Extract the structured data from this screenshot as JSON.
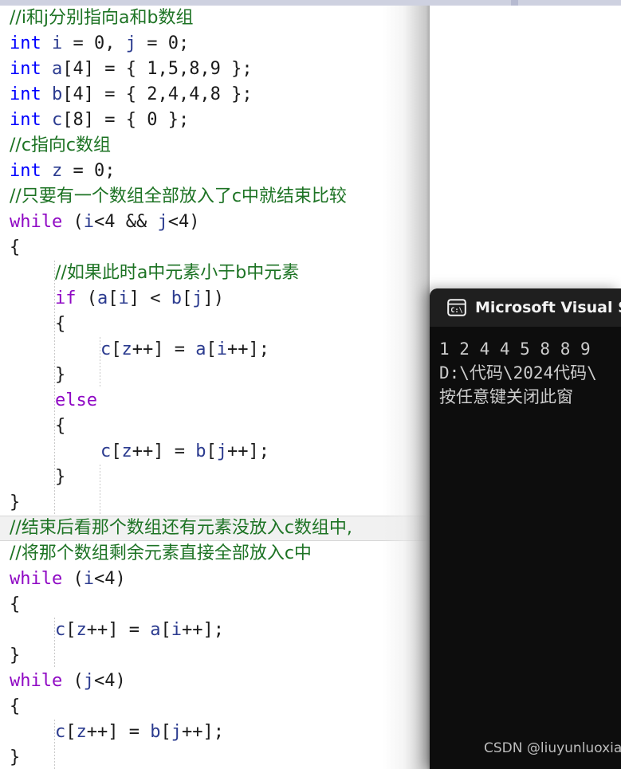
{
  "window": {
    "title": "Visual Studio code editor with console output"
  },
  "top_scrollbar": {
    "track_color": "#ced1e0",
    "thumb_color": "#b6bad0"
  },
  "editor": {
    "background": "#ffffff",
    "font_size_px": 22,
    "line_height_px": 32,
    "current_line_index": 20,
    "colors": {
      "comment": "#1d7324",
      "keyword": "#0000ff",
      "control": "#8f08c4",
      "identifier": "#2b3b8f",
      "plain": "#1b1b1b"
    },
    "lines": [
      {
        "indent": 0,
        "tokens": [
          {
            "t": "//i和j分别指向a和b数组",
            "c": "comment"
          }
        ]
      },
      {
        "indent": 0,
        "tokens": [
          {
            "t": "int",
            "c": "keyword"
          },
          {
            "t": " ",
            "c": "plain"
          },
          {
            "t": "i",
            "c": "identifier"
          },
          {
            "t": " = ",
            "c": "plain"
          },
          {
            "t": "0",
            "c": "plain"
          },
          {
            "t": ", ",
            "c": "plain"
          },
          {
            "t": "j",
            "c": "identifier"
          },
          {
            "t": " = ",
            "c": "plain"
          },
          {
            "t": "0;",
            "c": "plain"
          }
        ]
      },
      {
        "indent": 0,
        "tokens": [
          {
            "t": "int",
            "c": "keyword"
          },
          {
            "t": " ",
            "c": "plain"
          },
          {
            "t": "a",
            "c": "identifier"
          },
          {
            "t": "[4] = { 1,5,8,9 };",
            "c": "plain"
          }
        ]
      },
      {
        "indent": 0,
        "tokens": [
          {
            "t": "int",
            "c": "keyword"
          },
          {
            "t": " ",
            "c": "plain"
          },
          {
            "t": "b",
            "c": "identifier"
          },
          {
            "t": "[4] = { 2,4,4,8 };",
            "c": "plain"
          }
        ]
      },
      {
        "indent": 0,
        "tokens": [
          {
            "t": "int",
            "c": "keyword"
          },
          {
            "t": " ",
            "c": "plain"
          },
          {
            "t": "c",
            "c": "identifier"
          },
          {
            "t": "[8] = { 0 };",
            "c": "plain"
          }
        ]
      },
      {
        "indent": 0,
        "tokens": [
          {
            "t": "//c指向c数组",
            "c": "comment"
          }
        ]
      },
      {
        "indent": 0,
        "tokens": [
          {
            "t": "int",
            "c": "keyword"
          },
          {
            "t": " ",
            "c": "plain"
          },
          {
            "t": "z",
            "c": "identifier"
          },
          {
            "t": " = ",
            "c": "plain"
          },
          {
            "t": "0;",
            "c": "plain"
          }
        ]
      },
      {
        "indent": 0,
        "tokens": [
          {
            "t": "//只要有一个数组全部放入了c中就结束比较",
            "c": "comment"
          }
        ]
      },
      {
        "indent": 0,
        "tokens": [
          {
            "t": "while",
            "c": "control"
          },
          {
            "t": " (",
            "c": "plain"
          },
          {
            "t": "i",
            "c": "identifier"
          },
          {
            "t": "<4 && ",
            "c": "plain"
          },
          {
            "t": "j",
            "c": "identifier"
          },
          {
            "t": "<4)",
            "c": "plain"
          }
        ]
      },
      {
        "indent": 0,
        "tokens": [
          {
            "t": "{",
            "c": "plain"
          }
        ]
      },
      {
        "indent": 1,
        "tokens": [
          {
            "t": "//如果此时a中元素小于b中元素",
            "c": "comment"
          }
        ]
      },
      {
        "indent": 1,
        "tokens": [
          {
            "t": "if",
            "c": "control"
          },
          {
            "t": " (",
            "c": "plain"
          },
          {
            "t": "a",
            "c": "identifier"
          },
          {
            "t": "[",
            "c": "plain"
          },
          {
            "t": "i",
            "c": "identifier"
          },
          {
            "t": "] < ",
            "c": "plain"
          },
          {
            "t": "b",
            "c": "identifier"
          },
          {
            "t": "[",
            "c": "plain"
          },
          {
            "t": "j",
            "c": "identifier"
          },
          {
            "t": "])",
            "c": "plain"
          }
        ]
      },
      {
        "indent": 1,
        "tokens": [
          {
            "t": "{",
            "c": "plain"
          }
        ]
      },
      {
        "indent": 2,
        "tokens": [
          {
            "t": "c",
            "c": "identifier"
          },
          {
            "t": "[",
            "c": "plain"
          },
          {
            "t": "z",
            "c": "identifier"
          },
          {
            "t": "++] = ",
            "c": "plain"
          },
          {
            "t": "a",
            "c": "identifier"
          },
          {
            "t": "[",
            "c": "plain"
          },
          {
            "t": "i",
            "c": "identifier"
          },
          {
            "t": "++];",
            "c": "plain"
          }
        ]
      },
      {
        "indent": 1,
        "tokens": [
          {
            "t": "}",
            "c": "plain"
          }
        ]
      },
      {
        "indent": 1,
        "tokens": [
          {
            "t": "else",
            "c": "control"
          }
        ]
      },
      {
        "indent": 1,
        "tokens": [
          {
            "t": "{",
            "c": "plain"
          }
        ]
      },
      {
        "indent": 2,
        "tokens": [
          {
            "t": "c",
            "c": "identifier"
          },
          {
            "t": "[",
            "c": "plain"
          },
          {
            "t": "z",
            "c": "identifier"
          },
          {
            "t": "++] = ",
            "c": "plain"
          },
          {
            "t": "b",
            "c": "identifier"
          },
          {
            "t": "[",
            "c": "plain"
          },
          {
            "t": "j",
            "c": "identifier"
          },
          {
            "t": "++];",
            "c": "plain"
          }
        ]
      },
      {
        "indent": 1,
        "tokens": [
          {
            "t": "}",
            "c": "plain"
          }
        ]
      },
      {
        "indent": 0,
        "tokens": [
          {
            "t": "}",
            "c": "plain"
          }
        ]
      },
      {
        "indent": 0,
        "tokens": [
          {
            "t": "//结束后看那个数组还有元素没放入c数组中,",
            "c": "comment"
          }
        ]
      },
      {
        "indent": 0,
        "tokens": [
          {
            "t": "//将那个数组剩余元素直接全部放入c中",
            "c": "comment"
          }
        ]
      },
      {
        "indent": 0,
        "tokens": [
          {
            "t": "while",
            "c": "control"
          },
          {
            "t": " (",
            "c": "plain"
          },
          {
            "t": "i",
            "c": "identifier"
          },
          {
            "t": "<4)",
            "c": "plain"
          }
        ]
      },
      {
        "indent": 0,
        "tokens": [
          {
            "t": "{",
            "c": "plain"
          }
        ]
      },
      {
        "indent": 1,
        "tokens": [
          {
            "t": "c",
            "c": "identifier"
          },
          {
            "t": "[",
            "c": "plain"
          },
          {
            "t": "z",
            "c": "identifier"
          },
          {
            "t": "++] = ",
            "c": "plain"
          },
          {
            "t": "a",
            "c": "identifier"
          },
          {
            "t": "[",
            "c": "plain"
          },
          {
            "t": "i",
            "c": "identifier"
          },
          {
            "t": "++];",
            "c": "plain"
          }
        ]
      },
      {
        "indent": 0,
        "tokens": [
          {
            "t": "}",
            "c": "plain"
          }
        ]
      },
      {
        "indent": 0,
        "tokens": [
          {
            "t": "while",
            "c": "control"
          },
          {
            "t": " (",
            "c": "plain"
          },
          {
            "t": "j",
            "c": "identifier"
          },
          {
            "t": "<4)",
            "c": "plain"
          }
        ]
      },
      {
        "indent": 0,
        "tokens": [
          {
            "t": "{",
            "c": "plain"
          }
        ]
      },
      {
        "indent": 1,
        "tokens": [
          {
            "t": "c",
            "c": "identifier"
          },
          {
            "t": "[",
            "c": "plain"
          },
          {
            "t": "z",
            "c": "identifier"
          },
          {
            "t": "++] = ",
            "c": "plain"
          },
          {
            "t": "b",
            "c": "identifier"
          },
          {
            "t": "[",
            "c": "plain"
          },
          {
            "t": "j",
            "c": "identifier"
          },
          {
            "t": "++];",
            "c": "plain"
          }
        ]
      },
      {
        "indent": 0,
        "tokens": [
          {
            "t": "}",
            "c": "plain"
          }
        ]
      }
    ],
    "indent_guides": [
      {
        "indent": 1,
        "from_line": 10,
        "to_line": 19
      },
      {
        "indent": 2,
        "from_line": 13,
        "to_line": 14
      },
      {
        "indent": 2,
        "from_line": 18,
        "to_line": 19
      },
      {
        "indent": 1,
        "from_line": 24,
        "to_line": 25
      },
      {
        "indent": 1,
        "from_line": 28,
        "to_line": 29
      }
    ]
  },
  "console": {
    "icon": "console-cmd-icon",
    "icon_label": "C:\\",
    "title": "Microsoft Visual Stud",
    "background": "#0d0d0d",
    "titlebar_background": "#1f1f1f",
    "text_color": "#cccccc",
    "output_lines": [
      "1 2 4 4 5 8 8 9",
      "D:\\代码\\2024代码\\",
      "按任意键关闭此窗"
    ]
  },
  "watermark": {
    "text": "CSDN @liuyunluoxiao"
  }
}
